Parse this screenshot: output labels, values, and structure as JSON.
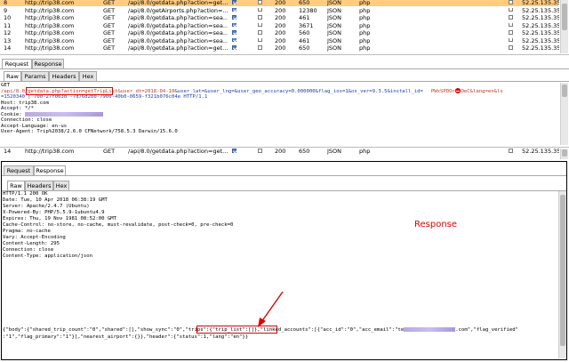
{
  "top_table": {
    "rows": [
      {
        "num": "8",
        "host": "http://trip38.com",
        "method": "GET",
        "url": "/api/8.0/getdata.php?action=get...",
        "chk1": true,
        "chk2": false,
        "status": "200",
        "length": "650",
        "mime": "JSON",
        "ext": "php",
        "chk3": false,
        "ip": "52.25.135.35",
        "selected": true
      },
      {
        "num": "9",
        "host": "http://trip38.com",
        "method": "GET",
        "url": "/api/8.0/getAirports.php?action=...",
        "chk1": true,
        "chk2": false,
        "status": "200",
        "length": "12380",
        "mime": "JSON",
        "ext": "php",
        "chk3": false,
        "ip": "52.25.135.35",
        "selected": false
      },
      {
        "num": "10",
        "host": "http://trip38.com",
        "method": "GET",
        "url": "/api/8.0/getdata.php?action=sea...",
        "chk1": true,
        "chk2": false,
        "status": "200",
        "length": "461",
        "mime": "JSON",
        "ext": "php",
        "chk3": false,
        "ip": "52.25.135.35",
        "selected": false
      },
      {
        "num": "11",
        "host": "http://trip38.com",
        "method": "GET",
        "url": "/api/8.0/getdata.php?action=sea...",
        "chk1": true,
        "chk2": false,
        "status": "200",
        "length": "3671",
        "mime": "JSON",
        "ext": "php",
        "chk3": false,
        "ip": "52.25.135.35",
        "selected": false
      },
      {
        "num": "12",
        "host": "http://trip38.com",
        "method": "GET",
        "url": "/api/8.0/getdata.php?action=sea...",
        "chk1": true,
        "chk2": false,
        "status": "200",
        "length": "560",
        "mime": "JSON",
        "ext": "php",
        "chk3": false,
        "ip": "52.25.135.35",
        "selected": false
      },
      {
        "num": "13",
        "host": "http://trip38.com",
        "method": "GET",
        "url": "/api/8.0/getdata.php?action=sea...",
        "chk1": true,
        "chk2": false,
        "status": "200",
        "length": "461",
        "mime": "JSON",
        "ext": "php",
        "chk3": false,
        "ip": "52.25.135.35",
        "selected": false
      },
      {
        "num": "14",
        "host": "http://trip38.com",
        "method": "GET",
        "url": "/api/8.0/getdata.php?action=get...",
        "chk1": true,
        "chk2": false,
        "status": "200",
        "length": "650",
        "mime": "JSON",
        "ext": "php",
        "chk3": false,
        "ip": "52.25.135.35",
        "selected": false
      }
    ]
  },
  "mid_table": {
    "rows": [
      {
        "num": "14",
        "host": "http://trip38.com",
        "method": "GET",
        "url": "/api/8.0/getdata.php?action=get...",
        "chk1": true,
        "chk2": false,
        "status": "200",
        "length": "650",
        "mime": "JSON",
        "ext": "php",
        "chk3": false,
        "ip": "52.25.135.35",
        "selected": false
      }
    ]
  },
  "req_tabs": {
    "request": "Request",
    "response": "Response"
  },
  "req_subtabs": {
    "raw": "Raw",
    "params": "Params",
    "headers": "Headers",
    "hex": "Hex"
  },
  "request_raw": {
    "l1": "GET",
    "l2_pre": "/api/8.0/",
    "l2_hl": "getdata.php?action=getTripList",
    "l2_mid": "&user_dt=2018-04-10",
    "l2_post": "&user_lat=&user_lng=&user_geo_accuracy=0.000000&flag_ios=1&os_ver=9.3.5&install_id=",
    "l2_tail": "PWxSPDOrbROeC&lang=en&ls",
    "l3": "=1520340 | 700-27f003d -7d76d200-7900-40b0-0659-f321b076c04e HTTP/1.1",
    "l4": "Host: trip38.com",
    "l5": "Accept: */*",
    "l6": "Cookie: ",
    "l7": "Connection: close",
    "l8": "Accept-Language: en-us",
    "l9": "User-Agent: Trip%2038/2.6.0 CFNetwork/758.5.3 Darwin/15.6.0"
  },
  "resp_tabs": {
    "request": "Request",
    "response": "Response"
  },
  "resp_subtabs": {
    "raw": "Raw",
    "headers": "Headers",
    "hex": "Hex"
  },
  "response_raw": {
    "h1": "HTTP/1.1 200 OK",
    "h2": "Date: Tue, 10 Apr 2018 06:38:19 GMT",
    "h3": "Server: Apache/2.4.7 (Ubuntu)",
    "h4": "X-Powered-By: PHP/5.5.9-1ubuntu4.9",
    "h5": "Expires: Thu, 19 Nov 1981 08:52:00 GMT",
    "h6": "Cache-Control: no-store, no-cache, must-revalidate, post-check=0, pre-check=0",
    "h7": "Pragma: no-cache",
    "h8": "Vary: Accept-Encoding",
    "h9": "Content-Length: 295",
    "h10": "Connection: close",
    "h11": "Content-Type: application/json",
    "b1_pre": "{\"body\":{\"shared_trip_count\":\"0\",\"shared\":[],\"show_sync\":\"0\",",
    "b1_hl": "\"trips\":{\"trip_list\":[]}",
    "b1_post": ",\"linked_accounts\":[{\"acc_id\":\"0\",\"acc_email\":\"te",
    "b1_post2": ".com\",\"flag_verified\"",
    "b2": ":\"1\",\"flag_primary\":\"1\"}],\"nearest_airport\":{}},\"header\":{\"status\":1,\"lang\":\"en\"}}"
  },
  "annotation": {
    "label": "Response"
  },
  "colors": {
    "selected_row": "#ffcc80",
    "annotation": "#e00000"
  }
}
